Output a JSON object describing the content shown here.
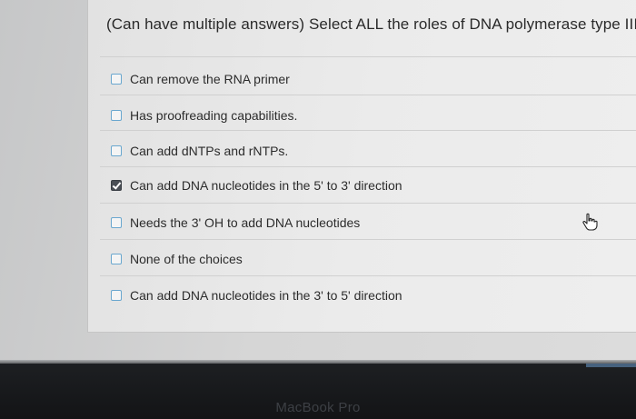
{
  "question": "(Can have multiple answers) Select ALL the roles of DNA polymerase type III.",
  "options": [
    {
      "label": "Can remove the RNA primer",
      "checked": false
    },
    {
      "label": "Has proofreading capabilities.",
      "checked": false
    },
    {
      "label": "Can add dNTPs and rNTPs.",
      "checked": false
    },
    {
      "label": "Can add DNA nucleotides in the 5' to 3' direction",
      "checked": true
    },
    {
      "label": "Needs the 3' OH to add DNA nucleotides",
      "checked": false
    },
    {
      "label": "None of the choices",
      "checked": false
    },
    {
      "label": "Can add DNA nucleotides in the 3' to 5' direction",
      "checked": false
    }
  ],
  "bezel": {
    "brand": "MacBook Pro"
  },
  "icons": {
    "cursor": "hand-pointer-icon"
  }
}
